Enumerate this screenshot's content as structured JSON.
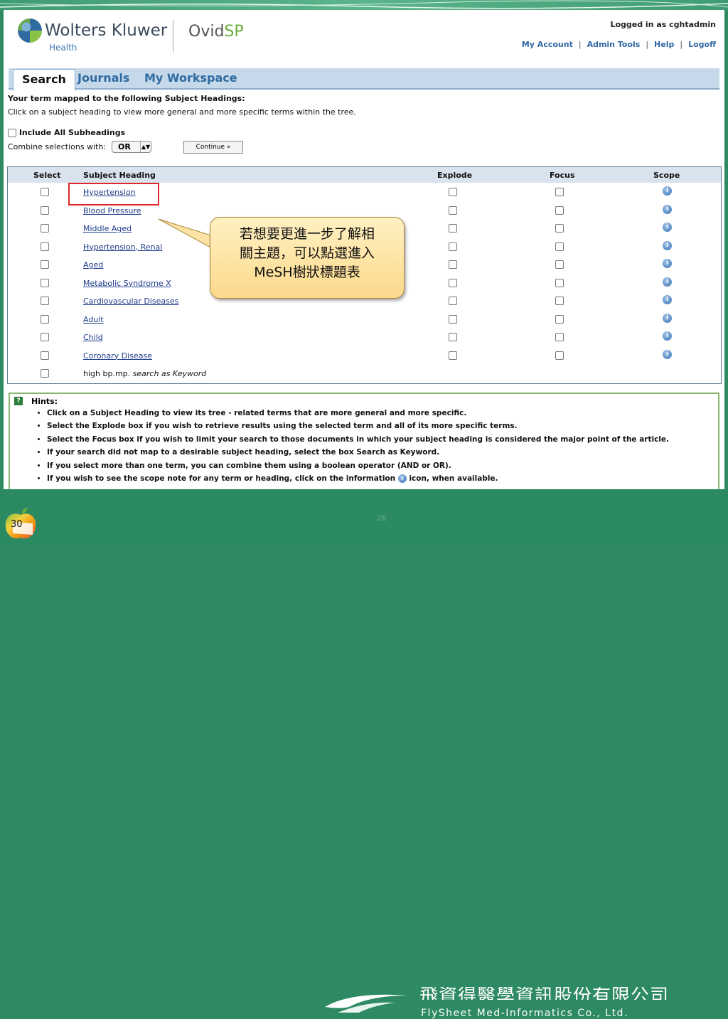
{
  "header": {
    "brand": "Wolters Kluwer",
    "brand_sub": "Health",
    "product_name": "Ovid",
    "product_suffix": "SP",
    "logged_in": "Logged in as cghtadmin",
    "links": [
      "My Account",
      "Admin Tools",
      "Help",
      "Logoff"
    ]
  },
  "tabs": [
    "Search",
    "Journals",
    "My Workspace"
  ],
  "intro": {
    "line1": "Your term mapped to the following Subject Headings:",
    "line2": "Click on a subject heading to view more general and more specific terms within the tree."
  },
  "controls": {
    "include_subheadings": "Include All Subheadings",
    "combine_label": "Combine selections with:",
    "combine_value": "OR",
    "continue_label": "Continue »"
  },
  "table": {
    "headers": [
      "Select",
      "Subject Heading",
      "Explode",
      "Focus",
      "Scope"
    ],
    "rows": [
      "Hypertension",
      "Blood Pressure",
      "Middle Aged",
      "Hypertension, Renal",
      "Aged",
      "Metabolic Syndrome X",
      "Cardiovascular Diseases",
      "Adult",
      "Child",
      "Coronary Disease"
    ],
    "keyword_row_term": "high bp.mp.",
    "keyword_row_suffix": "search as Keyword"
  },
  "callout": {
    "line1": "若想要更進一步了解相",
    "line2": "關主題，可以點選進入",
    "line3": "MeSH樹狀標題表"
  },
  "hints": {
    "title": "Hints:",
    "items": [
      "Click on a Subject Heading to view its tree - related terms that are more general and more specific.",
      "Select the Explode box if you wish to retrieve results using the selected term and all of its more specific terms.",
      "Select the Focus box if you wish to limit your search to those documents in which your subject heading is considered the major point of the article.",
      "If your search did not map to a desirable subject heading, select the box Search as Keyword.",
      "If you select more than one term, you can combine them using a boolean operator (AND or OR).",
      "If you wish to see the scope note for any term or heading, click on the information",
      "icon, when available."
    ]
  },
  "footer": {
    "slide_number": "30",
    "page_number": "26",
    "company_cn": "飛資得醫學資訊股份有限公司",
    "company_en": "FlySheet Med-Informatics Co., Ltd."
  },
  "colors": {
    "slide_green": "#2e8a63",
    "link_blue": "#1d3b8a",
    "highlight_red": "#e1262c",
    "callout_fill": "#fcd98c"
  }
}
